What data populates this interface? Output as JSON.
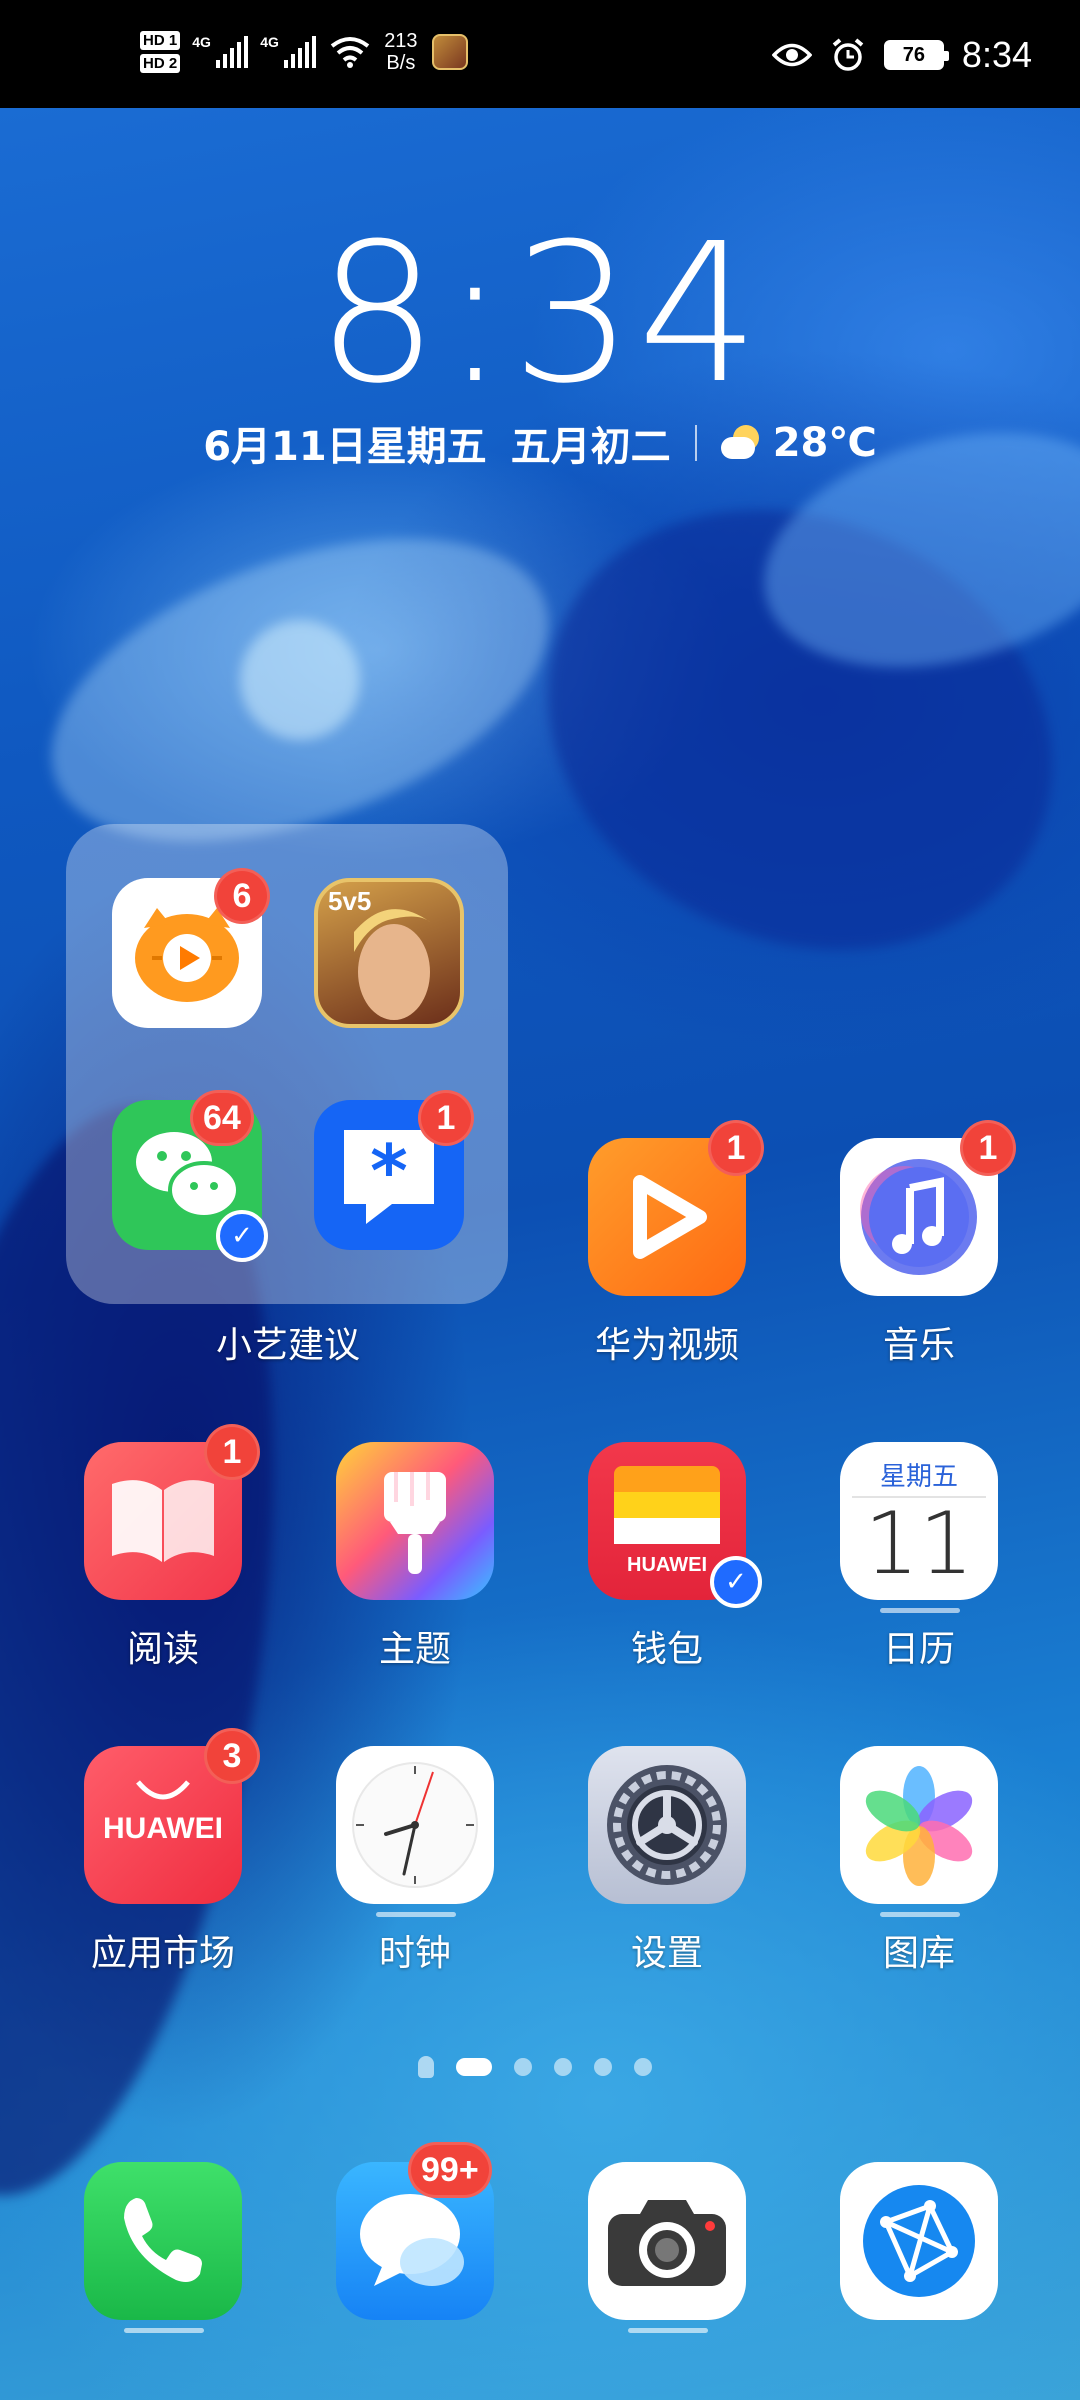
{
  "status_bar": {
    "sim1": "HD 1",
    "sim2": "HD 2",
    "net1": "4G",
    "net2": "4G",
    "speed_value": "213",
    "speed_unit": "B/s",
    "battery": "76",
    "time": "8:34"
  },
  "lockclock": {
    "time": "8:34",
    "date": "6月11日星期五",
    "lunar": "五月初二",
    "temperature": "28℃"
  },
  "folder": {
    "label": "小艺建议",
    "apps": [
      {
        "name": "huya-app",
        "badge": "6"
      },
      {
        "name": "honor-of-kings-app",
        "badge": ""
      },
      {
        "name": "wechat-app",
        "badge": "64"
      },
      {
        "name": "dingtalk-app",
        "badge": "1"
      }
    ]
  },
  "apps": {
    "video": {
      "label": "华为视频",
      "badge": "1"
    },
    "music": {
      "label": "音乐",
      "badge": "1"
    },
    "reading": {
      "label": "阅读",
      "badge": "1"
    },
    "themes": {
      "label": "主题"
    },
    "wallet": {
      "label": "钱包",
      "inner_text": "HUAWEI"
    },
    "calendar": {
      "label": "日历",
      "weekday": "星期五",
      "day": "11"
    },
    "appgallery": {
      "label": "应用市场",
      "badge": "3",
      "inner_text": "HUAWEI"
    },
    "clock": {
      "label": "时钟"
    },
    "settings": {
      "label": "设置"
    },
    "gallery": {
      "label": "图库"
    }
  },
  "dock": {
    "messages_badge": "99+"
  },
  "page_indicator": {
    "count": 5,
    "active": 1
  }
}
